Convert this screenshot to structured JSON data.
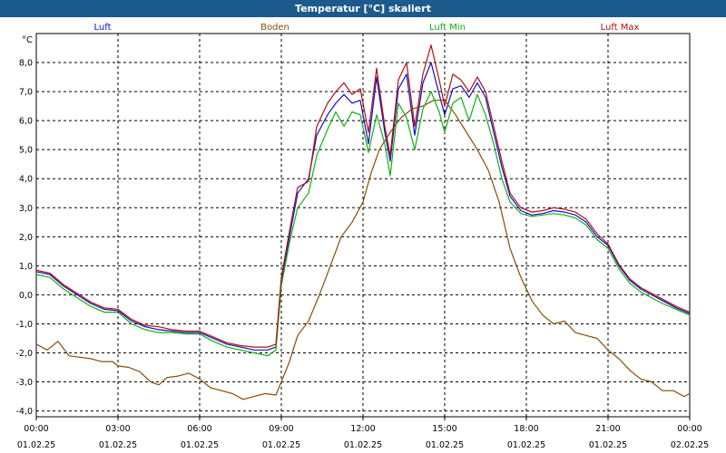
{
  "window": {
    "title": "Temperatur [°C] skaliert"
  },
  "chart_data": {
    "type": "line",
    "title": "Temperatur [°C] skaliert",
    "ylabel": "°C",
    "xlabel": "",
    "ylim": [
      -4.2,
      9.0
    ],
    "yticks": [
      -4.0,
      -3.0,
      -2.0,
      -1.0,
      0.0,
      1.0,
      2.0,
      3.0,
      4.0,
      5.0,
      6.0,
      7.0,
      8.0
    ],
    "ytick_labels": [
      "-4,0",
      "-3,0",
      "-2,0",
      "-1,0",
      "0,0",
      "1,0",
      "2,0",
      "3,0",
      "4,0",
      "5,0",
      "6,0",
      "7,0",
      "8,0"
    ],
    "xlim": [
      0,
      24
    ],
    "xticks": [
      {
        "x": 0,
        "time": "00:00",
        "date": "01.02.25"
      },
      {
        "x": 3,
        "time": "03:00",
        "date": "01.02.25"
      },
      {
        "x": 6,
        "time": "06:00",
        "date": "01.02.25"
      },
      {
        "x": 9,
        "time": "09:00",
        "date": "01.02.25"
      },
      {
        "x": 12,
        "time": "12:00",
        "date": "01.02.25"
      },
      {
        "x": 15,
        "time": "15:00",
        "date": "01.02.25"
      },
      {
        "x": 18,
        "time": "18:00",
        "date": "01.02.25"
      },
      {
        "x": 21,
        "time": "21:00",
        "date": "01.02.25"
      },
      {
        "x": 24,
        "time": "00:00",
        "date": "02.02.25"
      }
    ],
    "grid": true,
    "legend_position": "top",
    "series": [
      {
        "name": "Luft",
        "color": "#1010c8",
        "points": [
          [
            0,
            0.8
          ],
          [
            0.5,
            0.7
          ],
          [
            1,
            0.3
          ],
          [
            1.5,
            0
          ],
          [
            2,
            -0.3
          ],
          [
            2.5,
            -0.5
          ],
          [
            3,
            -0.55
          ],
          [
            3.5,
            -0.9
          ],
          [
            4,
            -1.1
          ],
          [
            4.5,
            -1.2
          ],
          [
            5,
            -1.25
          ],
          [
            5.5,
            -1.3
          ],
          [
            6,
            -1.3
          ],
          [
            6.5,
            -1.5
          ],
          [
            7,
            -1.7
          ],
          [
            7.5,
            -1.8
          ],
          [
            8,
            -1.9
          ],
          [
            8.5,
            -1.9
          ],
          [
            8.8,
            -1.8
          ],
          [
            9,
            0.5
          ],
          [
            9.3,
            2.0
          ],
          [
            9.6,
            3.5
          ],
          [
            10,
            4.0
          ],
          [
            10.3,
            5.5
          ],
          [
            10.7,
            6.2
          ],
          [
            11,
            6.6
          ],
          [
            11.3,
            6.9
          ],
          [
            11.6,
            6.6
          ],
          [
            11.9,
            6.7
          ],
          [
            12.2,
            5.2
          ],
          [
            12.5,
            7.5
          ],
          [
            12.8,
            5.6
          ],
          [
            13.0,
            4.6
          ],
          [
            13.3,
            7.1
          ],
          [
            13.6,
            7.6
          ],
          [
            13.9,
            5.5
          ],
          [
            14.2,
            7.3
          ],
          [
            14.5,
            8.0
          ],
          [
            14.8,
            6.9
          ],
          [
            15.0,
            6.2
          ],
          [
            15.3,
            7.1
          ],
          [
            15.6,
            7.2
          ],
          [
            15.9,
            6.8
          ],
          [
            16.2,
            7.3
          ],
          [
            16.5,
            6.8
          ],
          [
            16.8,
            5.6
          ],
          [
            17.1,
            4.4
          ],
          [
            17.4,
            3.4
          ],
          [
            17.8,
            2.9
          ],
          [
            18.2,
            2.75
          ],
          [
            18.6,
            2.8
          ],
          [
            19.0,
            2.9
          ],
          [
            19.4,
            2.85
          ],
          [
            19.8,
            2.75
          ],
          [
            20.2,
            2.5
          ],
          [
            20.6,
            2.0
          ],
          [
            21.0,
            1.7
          ],
          [
            21.4,
            1.0
          ],
          [
            21.8,
            0.5
          ],
          [
            22.2,
            0.2
          ],
          [
            22.6,
            0.0
          ],
          [
            23,
            -0.2
          ],
          [
            23.5,
            -0.45
          ],
          [
            24,
            -0.65
          ]
        ]
      },
      {
        "name": "Boden",
        "color": "#8b4b08",
        "points": [
          [
            0,
            -1.7
          ],
          [
            0.4,
            -1.9
          ],
          [
            0.8,
            -1.6
          ],
          [
            1.2,
            -2.1
          ],
          [
            1.6,
            -2.15
          ],
          [
            2,
            -2.2
          ],
          [
            2.4,
            -2.3
          ],
          [
            2.8,
            -2.3
          ],
          [
            3,
            -2.45
          ],
          [
            3.4,
            -2.5
          ],
          [
            3.8,
            -2.65
          ],
          [
            4.2,
            -3.0
          ],
          [
            4.5,
            -3.1
          ],
          [
            4.8,
            -2.85
          ],
          [
            5.2,
            -2.8
          ],
          [
            5.6,
            -2.7
          ],
          [
            6,
            -2.9
          ],
          [
            6.4,
            -3.2
          ],
          [
            6.8,
            -3.3
          ],
          [
            7.2,
            -3.4
          ],
          [
            7.6,
            -3.6
          ],
          [
            8,
            -3.5
          ],
          [
            8.4,
            -3.4
          ],
          [
            8.8,
            -3.45
          ],
          [
            9,
            -3.0
          ],
          [
            9.3,
            -2.3
          ],
          [
            9.6,
            -1.4
          ],
          [
            10,
            -0.9
          ],
          [
            10.4,
            0.0
          ],
          [
            10.8,
            1.0
          ],
          [
            11.2,
            2.0
          ],
          [
            11.6,
            2.5
          ],
          [
            12,
            3.2
          ],
          [
            12.3,
            4.2
          ],
          [
            12.6,
            5.0
          ],
          [
            13.0,
            5.6
          ],
          [
            13.4,
            6.1
          ],
          [
            13.8,
            6.4
          ],
          [
            14.2,
            6.5
          ],
          [
            14.6,
            6.7
          ],
          [
            15,
            6.7
          ],
          [
            15.4,
            6.2
          ],
          [
            15.8,
            5.6
          ],
          [
            16.2,
            5.0
          ],
          [
            16.6,
            4.3
          ],
          [
            17.0,
            3.2
          ],
          [
            17.4,
            1.6
          ],
          [
            17.8,
            0.6
          ],
          [
            18.2,
            -0.2
          ],
          [
            18.6,
            -0.7
          ],
          [
            19,
            -1.0
          ],
          [
            19.4,
            -0.9
          ],
          [
            19.8,
            -1.3
          ],
          [
            20.2,
            -1.4
          ],
          [
            20.6,
            -1.5
          ],
          [
            21,
            -1.9
          ],
          [
            21.4,
            -2.2
          ],
          [
            21.8,
            -2.6
          ],
          [
            22.2,
            -2.9
          ],
          [
            22.6,
            -3.0
          ],
          [
            23,
            -3.3
          ],
          [
            23.4,
            -3.3
          ],
          [
            23.8,
            -3.5
          ],
          [
            24,
            -3.4
          ]
        ]
      },
      {
        "name": "Luft Min",
        "color": "#10b010",
        "points": [
          [
            0,
            0.7
          ],
          [
            0.5,
            0.6
          ],
          [
            1,
            0.2
          ],
          [
            1.5,
            -0.1
          ],
          [
            2,
            -0.4
          ],
          [
            2.5,
            -0.6
          ],
          [
            3,
            -0.6
          ],
          [
            3.5,
            -1.0
          ],
          [
            4,
            -1.2
          ],
          [
            4.5,
            -1.3
          ],
          [
            5,
            -1.3
          ],
          [
            5.5,
            -1.35
          ],
          [
            6,
            -1.35
          ],
          [
            6.5,
            -1.6
          ],
          [
            7,
            -1.8
          ],
          [
            7.5,
            -1.9
          ],
          [
            8,
            -2.0
          ],
          [
            8.5,
            -2.1
          ],
          [
            8.8,
            -1.9
          ],
          [
            9,
            0.3
          ],
          [
            9.3,
            1.8
          ],
          [
            9.6,
            3.0
          ],
          [
            10,
            3.5
          ],
          [
            10.3,
            4.8
          ],
          [
            10.7,
            5.7
          ],
          [
            11,
            6.3
          ],
          [
            11.3,
            5.8
          ],
          [
            11.6,
            6.3
          ],
          [
            11.9,
            6.2
          ],
          [
            12.2,
            4.9
          ],
          [
            12.5,
            6.2
          ],
          [
            12.8,
            5.2
          ],
          [
            13.0,
            4.1
          ],
          [
            13.3,
            6.6
          ],
          [
            13.6,
            6.1
          ],
          [
            13.9,
            5.0
          ],
          [
            14.2,
            6.4
          ],
          [
            14.5,
            7.0
          ],
          [
            14.8,
            6.3
          ],
          [
            15.0,
            5.6
          ],
          [
            15.3,
            6.6
          ],
          [
            15.6,
            6.8
          ],
          [
            15.9,
            6.0
          ],
          [
            16.2,
            6.9
          ],
          [
            16.5,
            6.2
          ],
          [
            16.8,
            5.2
          ],
          [
            17.1,
            4.0
          ],
          [
            17.4,
            3.2
          ],
          [
            17.8,
            2.8
          ],
          [
            18.2,
            2.7
          ],
          [
            18.6,
            2.75
          ],
          [
            19.0,
            2.8
          ],
          [
            19.4,
            2.75
          ],
          [
            19.8,
            2.65
          ],
          [
            20.2,
            2.4
          ],
          [
            20.6,
            1.9
          ],
          [
            21.0,
            1.6
          ],
          [
            21.4,
            0.9
          ],
          [
            21.8,
            0.4
          ],
          [
            22.2,
            0.1
          ],
          [
            22.6,
            -0.1
          ],
          [
            23,
            -0.3
          ],
          [
            23.5,
            -0.5
          ],
          [
            24,
            -0.7
          ]
        ]
      },
      {
        "name": "Luft Max",
        "color": "#b01010",
        "points": [
          [
            0,
            0.85
          ],
          [
            0.5,
            0.75
          ],
          [
            1,
            0.35
          ],
          [
            1.5,
            0.05
          ],
          [
            2,
            -0.25
          ],
          [
            2.5,
            -0.45
          ],
          [
            3,
            -0.5
          ],
          [
            3.5,
            -0.85
          ],
          [
            4,
            -1.05
          ],
          [
            4.5,
            -1.1
          ],
          [
            5,
            -1.2
          ],
          [
            5.5,
            -1.25
          ],
          [
            6,
            -1.25
          ],
          [
            6.5,
            -1.45
          ],
          [
            7,
            -1.65
          ],
          [
            7.5,
            -1.75
          ],
          [
            8,
            -1.8
          ],
          [
            8.5,
            -1.8
          ],
          [
            8.8,
            -1.7
          ],
          [
            9,
            0.6
          ],
          [
            9.3,
            2.2
          ],
          [
            9.6,
            3.7
          ],
          [
            10,
            3.9
          ],
          [
            10.3,
            5.8
          ],
          [
            10.7,
            6.6
          ],
          [
            11,
            7.0
          ],
          [
            11.3,
            7.3
          ],
          [
            11.6,
            6.9
          ],
          [
            11.9,
            7.1
          ],
          [
            12.2,
            5.6
          ],
          [
            12.5,
            7.8
          ],
          [
            12.8,
            5.8
          ],
          [
            13.0,
            4.8
          ],
          [
            13.3,
            7.4
          ],
          [
            13.6,
            8.0
          ],
          [
            13.9,
            5.8
          ],
          [
            14.2,
            7.6
          ],
          [
            14.5,
            8.6
          ],
          [
            14.8,
            7.4
          ],
          [
            15.0,
            6.5
          ],
          [
            15.3,
            7.6
          ],
          [
            15.6,
            7.4
          ],
          [
            15.9,
            7.0
          ],
          [
            16.2,
            7.5
          ],
          [
            16.5,
            7.0
          ],
          [
            16.8,
            5.8
          ],
          [
            17.1,
            4.6
          ],
          [
            17.4,
            3.5
          ],
          [
            17.8,
            3.0
          ],
          [
            18.2,
            2.85
          ],
          [
            18.6,
            2.9
          ],
          [
            19.0,
            3.0
          ],
          [
            19.4,
            2.95
          ],
          [
            19.8,
            2.85
          ],
          [
            20.2,
            2.6
          ],
          [
            20.6,
            2.1
          ],
          [
            21.0,
            1.75
          ],
          [
            21.4,
            1.05
          ],
          [
            21.8,
            0.55
          ],
          [
            22.2,
            0.25
          ],
          [
            22.6,
            0.05
          ],
          [
            23,
            -0.15
          ],
          [
            23.5,
            -0.4
          ],
          [
            24,
            -0.6
          ]
        ]
      }
    ]
  }
}
